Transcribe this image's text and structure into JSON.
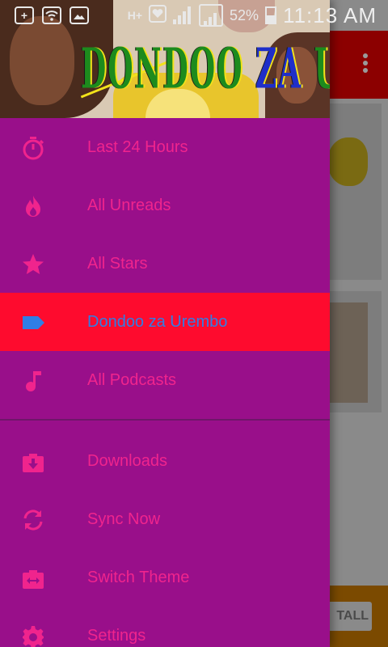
{
  "status_bar": {
    "network": "H+",
    "battery_percent": "52%",
    "time": "11:13 AM",
    "icons": [
      "plus-icon",
      "wifi-icon",
      "image-icon",
      "hplus-icon",
      "heart-icon",
      "signal-icon",
      "signal-icon",
      "battery-icon"
    ]
  },
  "drawer": {
    "header_title": "DONDOO ZA UREMBO",
    "header_title_part1": "DONDOO ",
    "header_title_part2": "ZA ",
    "header_title_part3": "UREMBO",
    "items_primary": [
      {
        "label": "Last 24 Hours",
        "icon": "stopwatch-icon",
        "active": false
      },
      {
        "label": "All Unreads",
        "icon": "flame-icon",
        "active": false
      },
      {
        "label": "All Stars",
        "icon": "star-icon",
        "active": false
      },
      {
        "label": "Dondoo za Urembo",
        "icon": "label-tag-icon",
        "active": true
      },
      {
        "label": "All Podcasts",
        "icon": "music-note-icon",
        "active": false
      }
    ],
    "items_secondary": [
      {
        "label": "Downloads",
        "icon": "download-icon"
      },
      {
        "label": "Sync Now",
        "icon": "sync-icon"
      },
      {
        "label": "Switch Theme",
        "icon": "switch-theme-icon"
      },
      {
        "label": "Settings",
        "icon": "settings-gear-icon"
      }
    ]
  },
  "background": {
    "install_button_label": "TALL"
  },
  "colors": {
    "drawer_bg": "#990f8a",
    "active_bg": "#fe0b2e",
    "item_text": "#f0248d",
    "active_text": "#2f7ee6",
    "toolbar_bg": "#8c0000"
  }
}
